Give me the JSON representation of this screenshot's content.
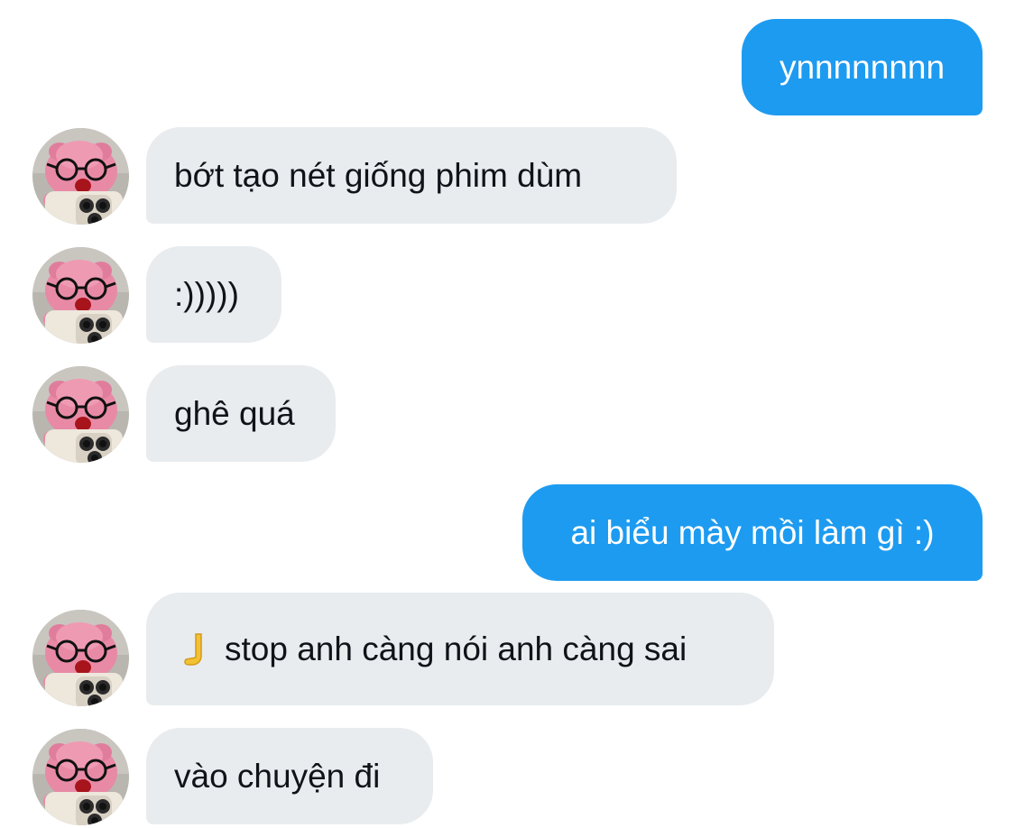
{
  "conversation": {
    "messages": [
      {
        "direction": "outgoing",
        "text": "ynnnnnnnn"
      },
      {
        "direction": "incoming",
        "text": "bớt tạo nét giống phim dùm"
      },
      {
        "direction": "incoming",
        "text": ":)))))"
      },
      {
        "direction": "incoming",
        "text": "ghê quá"
      },
      {
        "direction": "outgoing",
        "text": "ai biểu mày mồi làm gì :)"
      },
      {
        "direction": "incoming",
        "emoji": "backhand-index-pointing-down",
        "text": "stop anh càng nói anh càng sai"
      },
      {
        "direction": "incoming",
        "text": "vào chuyện đi"
      }
    ],
    "avatar_icon": "pink-plush-toy-with-glasses-and-phone-avatar",
    "colors": {
      "outgoing_bubble": "#1d9bf0",
      "outgoing_text": "#ffffff",
      "incoming_bubble": "#e8ecef",
      "incoming_text": "#0f1419"
    }
  }
}
